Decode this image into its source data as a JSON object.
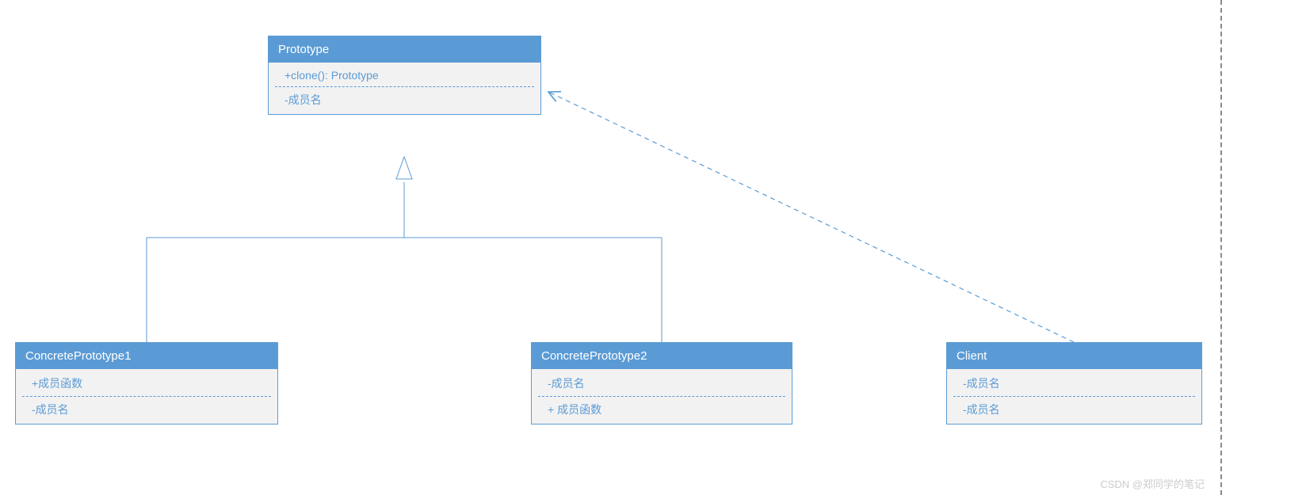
{
  "classes": {
    "prototype": {
      "name": "Prototype",
      "members": [
        "+clone(): Prototype",
        "-成员名"
      ]
    },
    "concrete1": {
      "name": "ConcretePrototype1",
      "members": [
        "+成员函数",
        "-成员名"
      ]
    },
    "concrete2": {
      "name": "ConcretePrototype2",
      "members": [
        "-成员名",
        "+ 成员函数"
      ]
    },
    "client": {
      "name": "Client",
      "members": [
        "-成员名",
        "-成员名"
      ]
    }
  },
  "relations": {
    "inherit1": {
      "from": "ConcretePrototype1",
      "to": "Prototype",
      "type": "generalization"
    },
    "inherit2": {
      "from": "ConcretePrototype2",
      "to": "Prototype",
      "type": "generalization"
    },
    "depend1": {
      "from": "Client",
      "to": "Prototype",
      "type": "dependency"
    }
  },
  "watermark": "CSDN @郑同学的笔记"
}
